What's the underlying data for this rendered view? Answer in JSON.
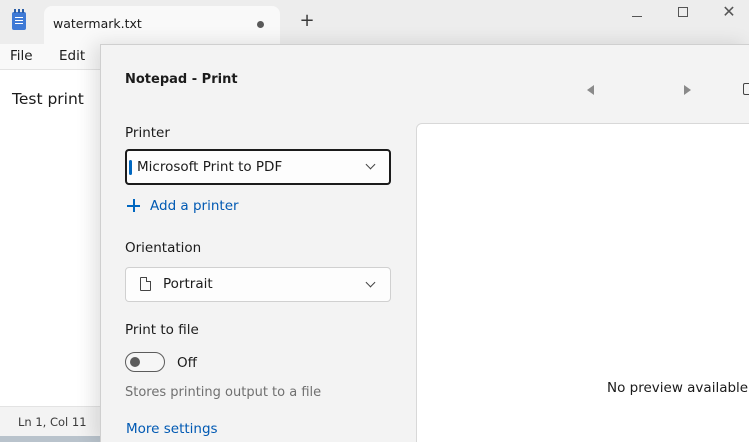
{
  "notepad": {
    "tab_title": "watermark.txt",
    "new_tab_symbol": "+",
    "close_symbol": "✕",
    "menus": [
      "File",
      "Edit"
    ],
    "document_text": "Test print",
    "status_position": "Ln 1, Col 11"
  },
  "print_dialog": {
    "title": "Notepad - Print",
    "printer": {
      "label": "Printer",
      "selected": "Microsoft Print to PDF",
      "add_printer": "Add a printer"
    },
    "orientation": {
      "label": "Orientation",
      "selected": "Portrait"
    },
    "print_to_file": {
      "label": "Print to file",
      "state": "Off",
      "description": "Stores printing output to a file"
    },
    "more_settings": "More settings",
    "preview_message": "No preview available"
  },
  "colors": {
    "accent": "#0067c0",
    "link": "#0059b3",
    "dialog_background": "#f3f3f3"
  },
  "icons": {
    "app": "notepad-icon",
    "previous_page": "chevron-left-icon",
    "next_page": "chevron-right-icon",
    "add": "plus-icon",
    "orientation": "page-icon",
    "dropdown": "chevron-down-icon"
  }
}
